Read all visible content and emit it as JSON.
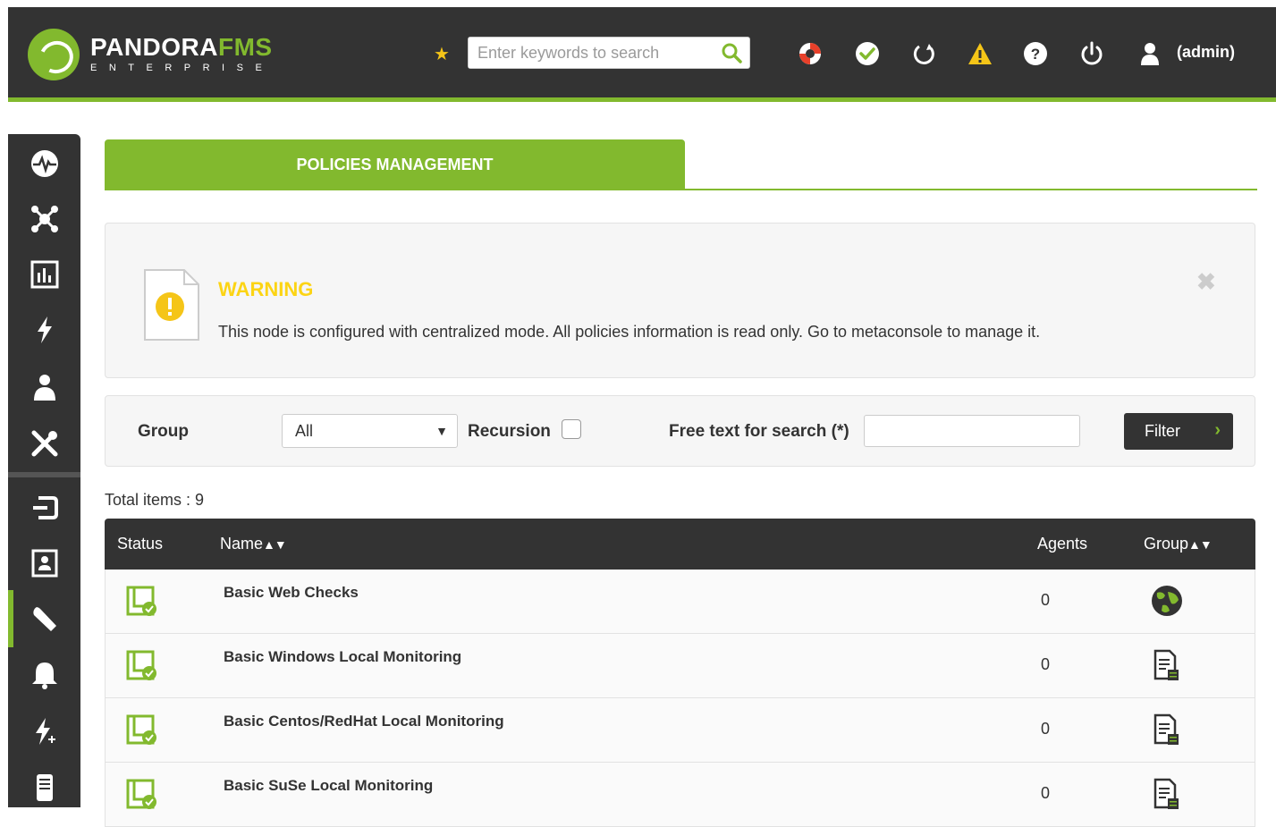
{
  "header": {
    "logo_main_1": "PANDORA",
    "logo_main_2": "FMS",
    "logo_sub": "ENTERPRISE",
    "search_placeholder": "Enter keywords to search",
    "user": "(admin)",
    "icons": [
      "lifebuoy-icon",
      "check-icon",
      "refresh-icon",
      "warning-icon",
      "help-icon",
      "power-icon",
      "user-icon"
    ]
  },
  "sidebar": {
    "items": [
      "monitoring-icon",
      "topology-icon",
      "reporting-icon",
      "events-icon",
      "users-icon",
      "tools-icon",
      "login-icon",
      "agent-icon",
      "wrench-icon",
      "alerts-icon",
      "events-plus-icon",
      "server-icon"
    ]
  },
  "page": {
    "tab_title": "POLICIES MANAGEMENT"
  },
  "warning": {
    "title": "WARNING",
    "text": "This node is configured with centralized mode. All policies information is read only. Go to metaconsole to manage it.",
    "close": "✖"
  },
  "filter": {
    "group_label": "Group",
    "group_value": "All",
    "recursion_label": "Recursion",
    "search_label": "Free text for search (*)",
    "button_label": "Filter"
  },
  "total_items": "Total items : 9",
  "table": {
    "columns": {
      "status": "Status",
      "name": "Name",
      "agents": "Agents",
      "group": "Group"
    },
    "rows": [
      {
        "name": "Basic Web Checks",
        "agents": "0",
        "group_icon": "globe-icon"
      },
      {
        "name": "Basic Windows Local Monitoring",
        "agents": "0",
        "group_icon": "server-group-icon"
      },
      {
        "name": "Basic Centos/RedHat Local Monitoring",
        "agents": "0",
        "group_icon": "server-group-icon"
      },
      {
        "name": "Basic SuSe Local Monitoring",
        "agents": "0",
        "group_icon": "server-group-icon"
      }
    ]
  },
  "colors": {
    "accent": "#82b92e",
    "header_bg": "#333333",
    "warning": "#fcd414"
  }
}
